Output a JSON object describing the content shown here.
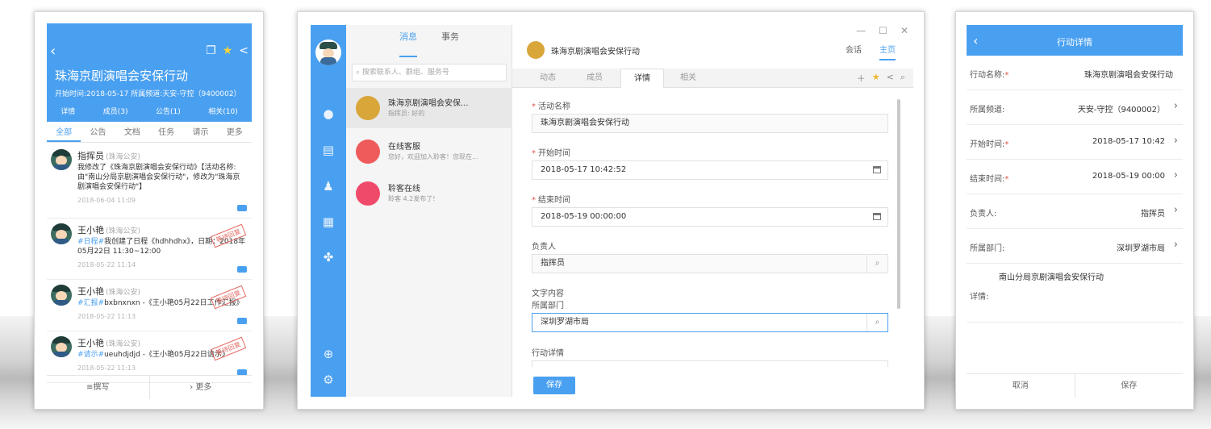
{
  "colors": {
    "accent": "#4aa0f0",
    "required": "#e0524a",
    "stamp": "#e0524a"
  },
  "phone1": {
    "back_icon": "chevron-left-icon",
    "title": "珠海京剧演唱会安保行动",
    "subtitle": "开始时间:2018-05-17    所属频道:天安-守控（9400002）",
    "tabs": [
      "详情",
      "成员(3)",
      "公告(1)",
      "相关(10)"
    ],
    "categories": [
      "全部",
      "公告",
      "文档",
      "任务",
      "请示",
      "更多"
    ],
    "feed": [
      {
        "name": "指挥员",
        "org": "(珠海公安)",
        "tag": "",
        "text": "我修改了《珠海京剧演唱会安保行动》【活动名称:由\"南山分局京剧演唱会安保行动\"，修改为\"珠海京剧演唱会安保行动\"】",
        "time": "2018-06-04 11:09",
        "stamp": ""
      },
      {
        "name": "王小艳",
        "org": "(珠海公安)",
        "tag": "#日程#",
        "text": "我创建了日程《hdhhdhx》，日期：2018年05月22日 11:30~12:00",
        "time": "2018-05-22 11:14",
        "stamp": "等待回复"
      },
      {
        "name": "王小艳",
        "org": "(珠海公安)",
        "tag": "#汇报#",
        "text": "bxbnxnxn -《王小艳05月22日工作汇报》",
        "time": "2018-05-22 11:13",
        "stamp": "等待回复"
      },
      {
        "name": "王小艳",
        "org": "(珠海公安)",
        "tag": "#请示#",
        "text": "ueuhdjdjd -《王小艳05月22日请示》",
        "time": "2018-05-22 11:13",
        "stamp": "等待回复"
      }
    ],
    "bottom": [
      "≡撰写",
      "› 更多"
    ]
  },
  "desktop": {
    "window_controls": [
      "—",
      "☐",
      "✕"
    ],
    "convo_tabs": [
      "消息",
      "事务"
    ],
    "search_placeholder": "搜索联系人、群组、服务号",
    "conversations": [
      {
        "title": "珠海京剧演唱会安保...",
        "preview": "指挥员: 好的",
        "color": "#d9a63a"
      },
      {
        "title": "在线客服",
        "preview": "您好，欢迎加入聆客！您现在...",
        "color": "#ef5b5b"
      },
      {
        "title": "聆客在线",
        "preview": "聆客 4.2发布了!",
        "color": "#f04a6a"
      }
    ],
    "title": "珠海京剧演唱会安保行动",
    "nav": [
      "会话",
      "主页"
    ],
    "subtabs": [
      "动态",
      "成员",
      "详情",
      "相关"
    ],
    "fields": {
      "name_label": "活动名称",
      "name_value": "珠海京剧演唱会安保行动",
      "start_label": "开始时间",
      "start_value": "2018-05-17 10:42:52",
      "end_label": "结束时间",
      "end_value": "2018-05-19 00:00:00",
      "owner_label": "负责人",
      "owner_value": "指挥员",
      "content_label": "文字内容",
      "dept_label": "所属部门",
      "dept_value": "深圳罗湖市局",
      "detail_label": "行动详情"
    },
    "save_label": "保存"
  },
  "phone2": {
    "title": "行动详情",
    "rows": [
      {
        "label": "行动名称:",
        "required": true,
        "value": "珠海京剧演唱会安保行动",
        "arrow": false
      },
      {
        "label": "所属频道:",
        "required": false,
        "value": "天安-守控（9400002）",
        "arrow": true
      },
      {
        "label": "开始时间:",
        "required": true,
        "value": "2018-05-17 10:42",
        "arrow": true
      },
      {
        "label": "结束时间:",
        "required": true,
        "value": "2018-05-19 00:00",
        "arrow": true
      },
      {
        "label": "负责人:",
        "required": false,
        "value": "指挥员",
        "arrow": true
      },
      {
        "label": "所属部门:",
        "required": false,
        "value": "深圳罗湖市局",
        "arrow": true
      }
    ],
    "detail_value": "南山分局京剧演唱会安保行动",
    "detail_label": "详情:",
    "bottom": [
      "取消",
      "保存"
    ]
  }
}
